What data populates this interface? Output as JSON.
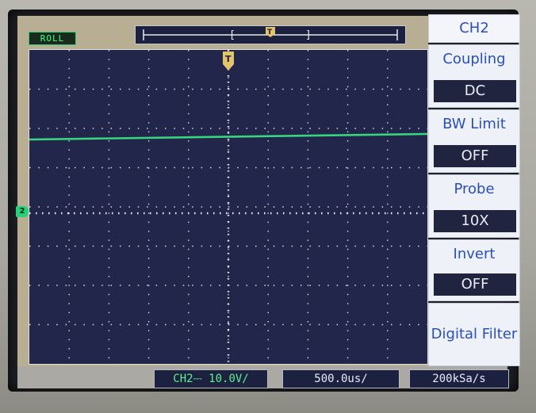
{
  "status": {
    "indicator": "ROLL"
  },
  "buffer": {
    "trigger_marker": "T",
    "left_bracket": "[",
    "right_bracket": "]"
  },
  "plot": {
    "trigger_glyph": "T",
    "channel_marker": "2",
    "trace_color": "#39d57c"
  },
  "menu": {
    "title": "CH2",
    "coupling": {
      "label": "Coupling",
      "value": "DC"
    },
    "bw_limit": {
      "label": "BW Limit",
      "value": "OFF"
    },
    "probe": {
      "label": "Probe",
      "value": "10X"
    },
    "invert": {
      "label": "Invert",
      "value": "OFF"
    },
    "digital_filter": {
      "label": "Digital Filter"
    }
  },
  "footer": {
    "channel_scale": "CH2⎓  10.0V/",
    "timebase": "500.0us/",
    "sample_rate": "200kSa/s"
  }
}
